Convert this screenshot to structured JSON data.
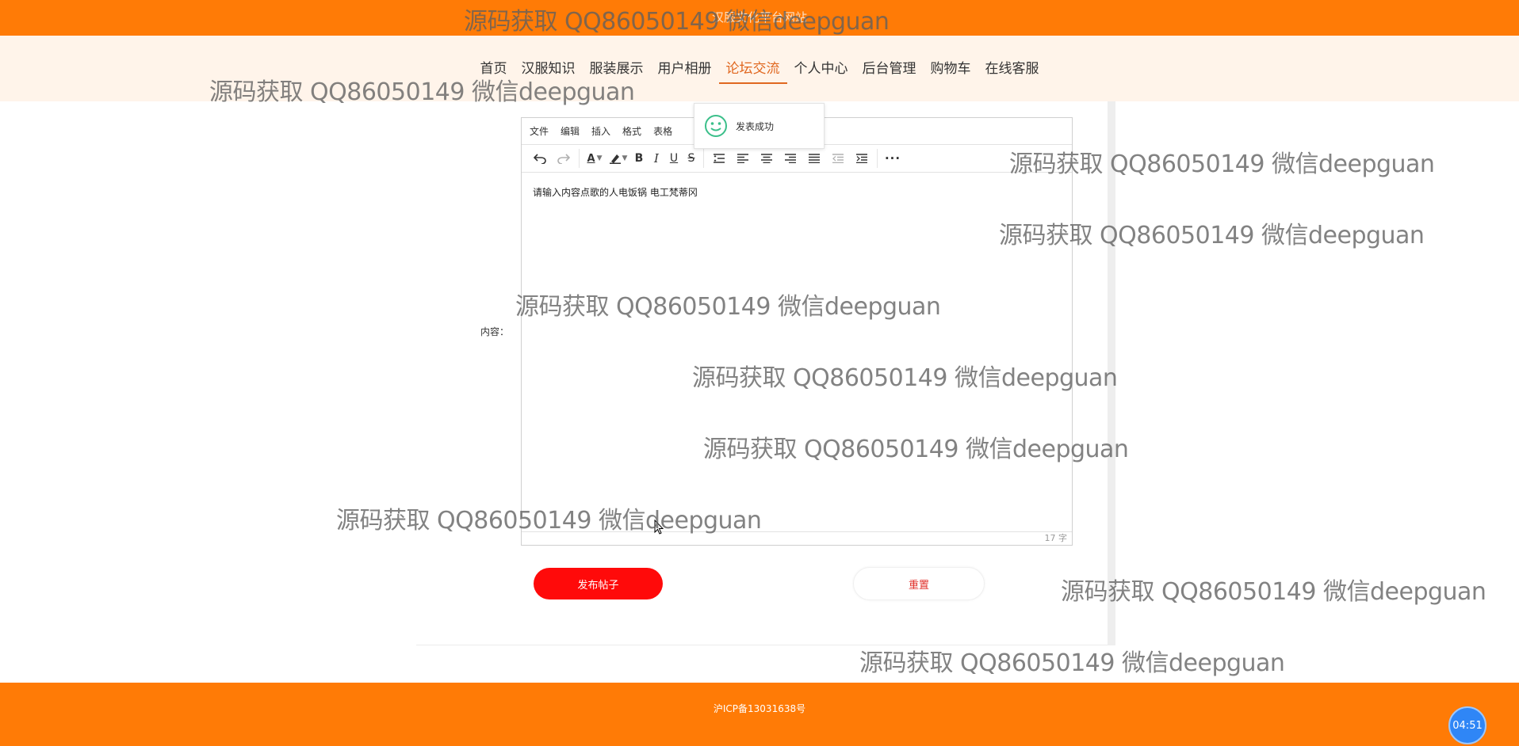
{
  "header": {
    "site_title": "汉服文化平台网站"
  },
  "nav": {
    "items": [
      "首页",
      "汉服知识",
      "服装展示",
      "用户相册",
      "论坛交流",
      "个人中心",
      "后台管理",
      "购物车",
      "在线客服"
    ],
    "active": "论坛交流"
  },
  "form": {
    "content_label": "内容：",
    "editor": {
      "menu": [
        "文件",
        "编辑",
        "插入",
        "格式",
        "表格"
      ],
      "toolbar_icons": [
        "undo-icon",
        "redo-icon",
        "text-color-icon",
        "highlight-icon",
        "bold-icon",
        "italic-icon",
        "underline-icon",
        "strikethrough-icon",
        "line-height-icon",
        "align-left-icon",
        "align-center-icon",
        "align-right-icon",
        "align-justify-icon",
        "outdent-icon",
        "indent-icon",
        "more-icon"
      ],
      "content": "请输入内容点歌的人电饭锅 电工梵蒂冈",
      "word_count": "17 字"
    },
    "publish_label": "发布帖子",
    "reset_label": "重置"
  },
  "toast": {
    "message": "发表成功"
  },
  "footer": {
    "icp": "沪ICP备13031638号"
  },
  "clock": {
    "time": "04:51"
  },
  "watermark": "源码获取 QQ86050149 微信deepguan",
  "colors": {
    "accent": "#ff7b06",
    "primary_button": "#ff0a0a",
    "active_nav": "#e0671f"
  }
}
